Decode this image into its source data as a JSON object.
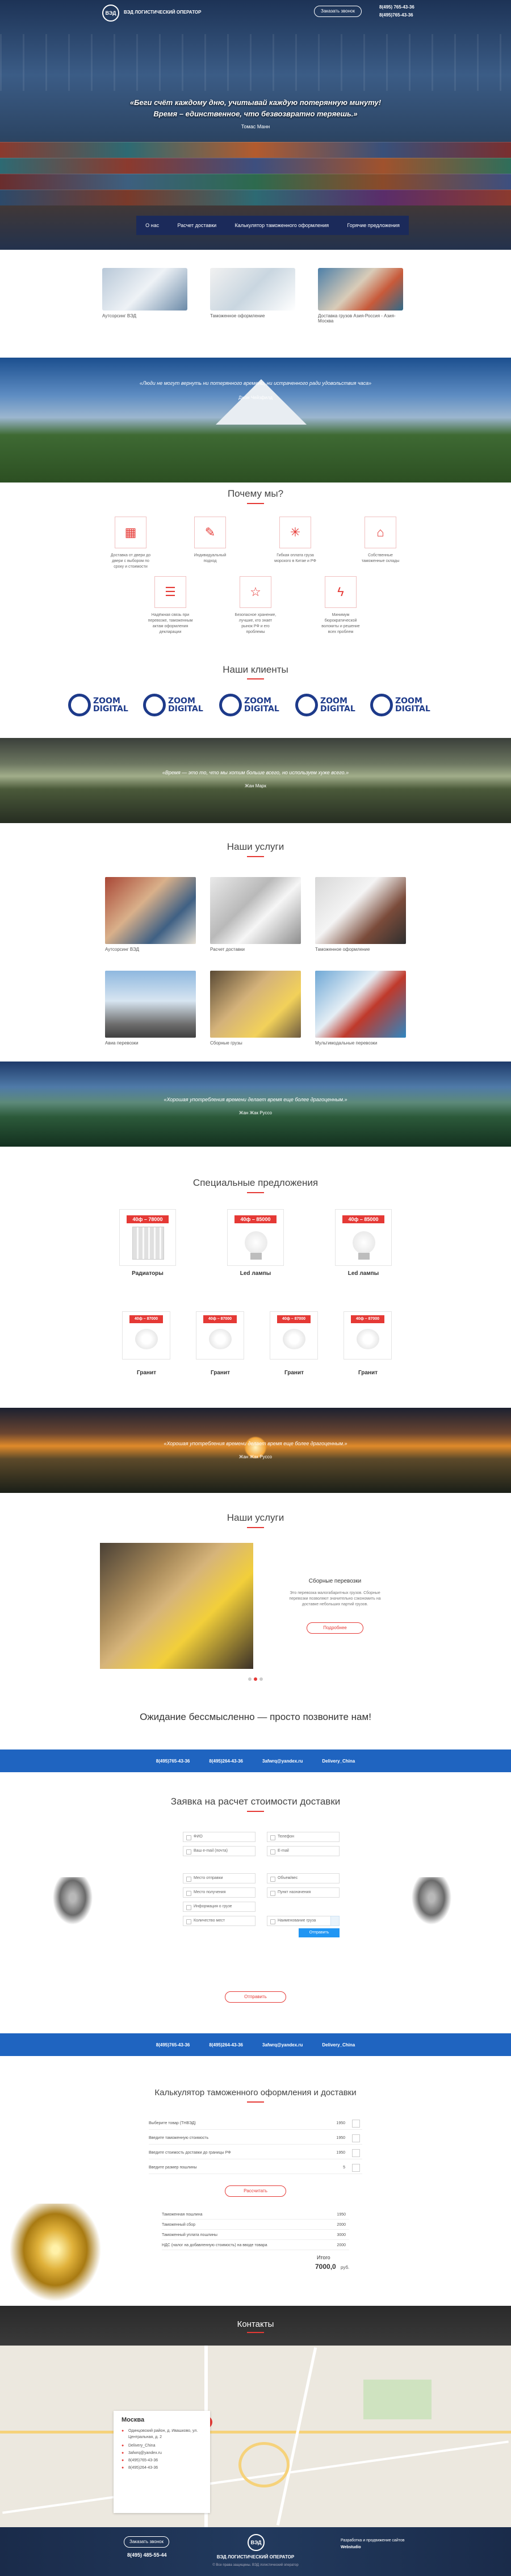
{
  "hero": {
    "company": "ВЭД ЛОГИСТИЧЕСКИЙ ОПЕРАТОР",
    "logo": "ВЭД",
    "callback_label": "Заказать звонок",
    "phones": [
      "8(495) 765-43-36",
      "8(495)765-43-36"
    ],
    "quote_1": "«Беги счёт каждому дню, учитывай каждую потерянную минуту!",
    "quote_2": "Время – единственное, что безвозвратно теряешь.»",
    "author": "Томас Манн"
  },
  "nav": [
    "О нас",
    "Расчет доставки",
    "Калькулятор таможенного оформления",
    "Горячие предложения"
  ],
  "intro": [
    {
      "caption": "Аутсорсинг ВЭД"
    },
    {
      "caption": "Таможенное оформление"
    },
    {
      "caption": "Доставка грузов Азия-Россия - Азия-Москва"
    }
  ],
  "band1": {
    "quote": "«Люди не могут вернуть ни потерянного времени, ни истраченного ради удовольствия часа»",
    "author": "Джон Чейзфилд"
  },
  "why": {
    "title": "Почему мы?",
    "items": [
      {
        "text": "Доставка от двери до двери с выбором по сроку и стоимости"
      },
      {
        "text": "Индивидуальный подход"
      },
      {
        "text": "Гибкая оплата груза морского в Китае и РФ"
      },
      {
        "text": "Собственные таможенные склады"
      },
      {
        "text": "Надёжная связь при перевозке, таможенным актам оформления декларации"
      },
      {
        "text": "Безопасное хранение, лучшие, кто знает рынок РФ и его проблемы"
      },
      {
        "text": "Минимум бюрократической волокиты и решение всех проблем"
      }
    ]
  },
  "clients": {
    "title": "Наши клиенты",
    "name_1": "ZOOM",
    "name_2": "DIGITAL",
    "count": 5
  },
  "band2": {
    "quote": "«Время — это то, что мы хотим больше всего, но используем хуже всего.»",
    "author": "Жан Марк"
  },
  "services": {
    "title": "Наши услуги",
    "items": [
      {
        "caption": "Аутсорсинг ВЭД"
      },
      {
        "caption": "Расчет доставки"
      },
      {
        "caption": "Таможенное оформление"
      },
      {
        "caption": "Авиа перевозки"
      },
      {
        "caption": "Сборные грузы"
      },
      {
        "caption": "Мультимодальные перевозки"
      }
    ]
  },
  "band3": {
    "quote": "«Хорошая употребления времени делает время еще более драгоценным.»",
    "author": "Жан Жак Руссо"
  },
  "offers": {
    "title": "Специальные предложения",
    "top": [
      {
        "price": "40ф – 78000",
        "name": "Радиаторы"
      },
      {
        "price": "40ф – 85000",
        "name": "Led лампы"
      },
      {
        "price": "40ф – 85000",
        "name": "Led лампы"
      }
    ],
    "bottom": [
      {
        "price": "40ф – 87000",
        "name": "Гранит"
      },
      {
        "price": "40ф – 87000",
        "name": "Гранит"
      },
      {
        "price": "40ф – 87000",
        "name": "Гранит"
      },
      {
        "price": "40ф – 87000",
        "name": "Гранит"
      }
    ]
  },
  "band4": {
    "quote": "«Хорошая употребления времени делает время еще более драгоценным.»",
    "author": "Жан Жак Руссо"
  },
  "services2": {
    "title": "Наши услуги",
    "slide_title": "Сборные перевозки",
    "slide_text": "Это перевозка малогабаритных грузов. Сборные перевозки позволяют значительно сэкономить на доставке небольших партий грузов.",
    "slide_button": "Подробнее",
    "dots": 3
  },
  "cta": {
    "title": "Ожидание бессмысленно — просто позвоните нам!"
  },
  "bluebar": {
    "phone_1": "8(495)765-43-36",
    "phone_2": "8(495)264-43-36",
    "email": "3afwrq@yandex.ru",
    "skype": "Delivery_China"
  },
  "form": {
    "title": "Заявка на расчет стоимости доставки",
    "fields": [
      "ФИО",
      "Телефон",
      "Ваш e-mail (почта)",
      "E-mail",
      "Место отправки",
      "Объем/вес",
      "Место получения",
      "Пункт назначения",
      "Информация о грузе",
      "Количество мест",
      "Наименование груза"
    ],
    "send_label": "Отправить",
    "detail_label": "Отправить"
  },
  "calc": {
    "title": "Калькулятор таможенного оформления и доставки",
    "rows": [
      {
        "label": "Выберите товар (ТНВЭД)",
        "value": "1950"
      },
      {
        "label": "Введите таможенную стоимость",
        "value": "1950"
      },
      {
        "label": "Введите стоимость доставки до границы РФ",
        "value": "1950"
      },
      {
        "label": "Введите размер пошлины",
        "value": "5"
      }
    ],
    "button": "Рассчитать",
    "results": [
      {
        "label": "Таможенная пошлина",
        "value": "1950"
      },
      {
        "label": "Таможенный сбор",
        "value": "2000"
      },
      {
        "label": "Таможенный уплата пошлины",
        "value": "3000"
      },
      {
        "label": "НДС (налог на добавленную стоимость) на вводе товара",
        "value": "2000"
      }
    ],
    "total_label": "Итого",
    "total_value": "7000,0",
    "currency": "руб."
  },
  "contacts": {
    "title": "Контакты",
    "city": "Москва",
    "lines": [
      "Одинцовский район, д. Ивашково, ул. Центральная, д. 2",
      "Delivery_China",
      "3afwrq@yandex.ru",
      "8(495)765-43-36",
      "8(495)264-43-36"
    ]
  },
  "footer": {
    "logo": "ВЭД",
    "company": "ВЭД ЛОГИСТИЧЕСКИЙ ОПЕРАТОР",
    "callback": "Заказать звонок",
    "phone": "8(495) 485-55-44",
    "right_1": "Разработка и продвижение сайтов",
    "right_2": "Webstudio",
    "copyright": "© Все права защищены. ВЭД логистический оператор"
  }
}
